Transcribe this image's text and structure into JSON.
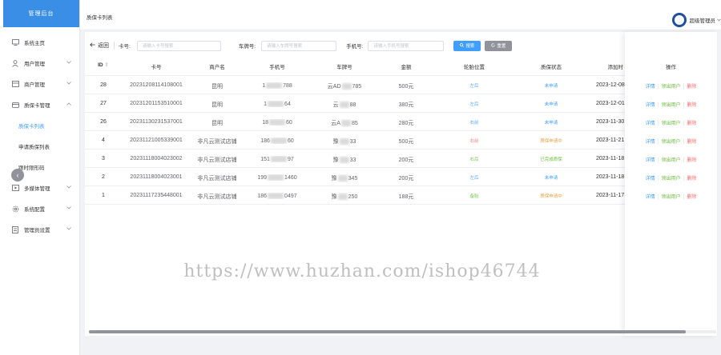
{
  "sidebar": {
    "logo_text": "管理后台",
    "items": [
      {
        "label": "系统主页",
        "icon": "monitor-icon"
      },
      {
        "label": "用户管理",
        "icon": "user-icon"
      },
      {
        "label": "商户管理",
        "icon": "store-icon"
      },
      {
        "label": "质保卡管理",
        "icon": "card-icon"
      },
      {
        "label": "质保卡列表",
        "icon": ""
      },
      {
        "label": "申请质保列表",
        "icon": ""
      },
      {
        "label": "跟时限形码",
        "icon": ""
      },
      {
        "label": "多媒体管理",
        "icon": "media-icon"
      },
      {
        "label": "系统配置",
        "icon": "gear-icon"
      },
      {
        "label": "管理员设置",
        "icon": "admin-icon"
      }
    ],
    "collapse_icon": "chevron-left-icon"
  },
  "header": {
    "title": "质保卡列表",
    "user_name": "超级管理员",
    "dropdown_icon": "chevron-down-icon"
  },
  "filters": {
    "back_label": "返回",
    "card_label": "卡号:",
    "card_placeholder": "请输入卡号搜索",
    "plate_label": "车牌号:",
    "plate_placeholder": "请输入车牌号搜索",
    "phone_label": "手机号:",
    "phone_placeholder": "请输入手机号搜索",
    "search_label": "搜索",
    "reset_label": "重置"
  },
  "table": {
    "headers": {
      "id": "ID",
      "card": "卡号",
      "merchant": "商户名",
      "phone": "手机号",
      "plate": "车牌号",
      "amount": "金额",
      "position": "轮胎位置",
      "status": "质保状态",
      "added": "添加时",
      "ops": "操作"
    },
    "rows": [
      {
        "id": "28",
        "card": "20231208114108001",
        "merchant": "昆明",
        "phone_a": "1",
        "phone_b": "788",
        "plate_a": "云AD",
        "plate_b": "785",
        "amount": "500元",
        "position": "左后",
        "status": "未申请",
        "added": "2023-12-08"
      },
      {
        "id": "27",
        "card": "20231201153510001",
        "merchant": "昆明",
        "phone_a": "1",
        "phone_b": "64",
        "plate_a": "云",
        "plate_b": "88",
        "amount": "380元",
        "position": "左后",
        "status": "未申请",
        "added": "2023-12-01"
      },
      {
        "id": "26",
        "card": "20231130231537001",
        "merchant": "昆明",
        "phone_a": "18",
        "phone_b": "60",
        "plate_a": "云A",
        "plate_b": "85",
        "amount": "280元",
        "position": "右前",
        "status": "未申请",
        "added": "2023-11-30"
      },
      {
        "id": "4",
        "card": "20231121005339001",
        "merchant": "非凡云测试店铺",
        "phone_a": "186",
        "phone_b": "60",
        "plate_a": "豫",
        "plate_b": "33",
        "amount": "500元",
        "position": "右前",
        "status": "质保申请中",
        "added": "2023-11-21"
      },
      {
        "id": "3",
        "card": "20231118004023002",
        "merchant": "非凡云测试店铺",
        "phone_a": "151",
        "phone_b": "97",
        "plate_a": "豫",
        "plate_b": "33",
        "amount": "200元",
        "position": "右后",
        "status": "已完成质保",
        "added": "2023-11-18"
      },
      {
        "id": "2",
        "card": "20231118004023001",
        "merchant": "非凡云测试店铺",
        "phone_a": "199",
        "phone_b": "1460",
        "plate_a": "豫",
        "plate_b": "345",
        "amount": "200元",
        "position": "左后",
        "status": "未申请",
        "added": "2023-11-18"
      },
      {
        "id": "1",
        "card": "20231117235448001",
        "merchant": "非凡云测试店铺",
        "phone_a": "186",
        "phone_b": "0497",
        "plate_a": "豫",
        "plate_b": "250",
        "amount": "188元",
        "position": "备胎",
        "status": "质保申请中",
        "added": "2023-11-17"
      }
    ],
    "actions": {
      "detail": "详情",
      "export": "领出用户",
      "delete": "删除"
    }
  },
  "watermark": "https://www.huzhan.com/ishop46744",
  "colors": {
    "primary": "#409eff",
    "success": "#67c23a",
    "warning": "#e6a23c",
    "danger": "#f56c6c",
    "position_teal": "#36cfc9"
  }
}
